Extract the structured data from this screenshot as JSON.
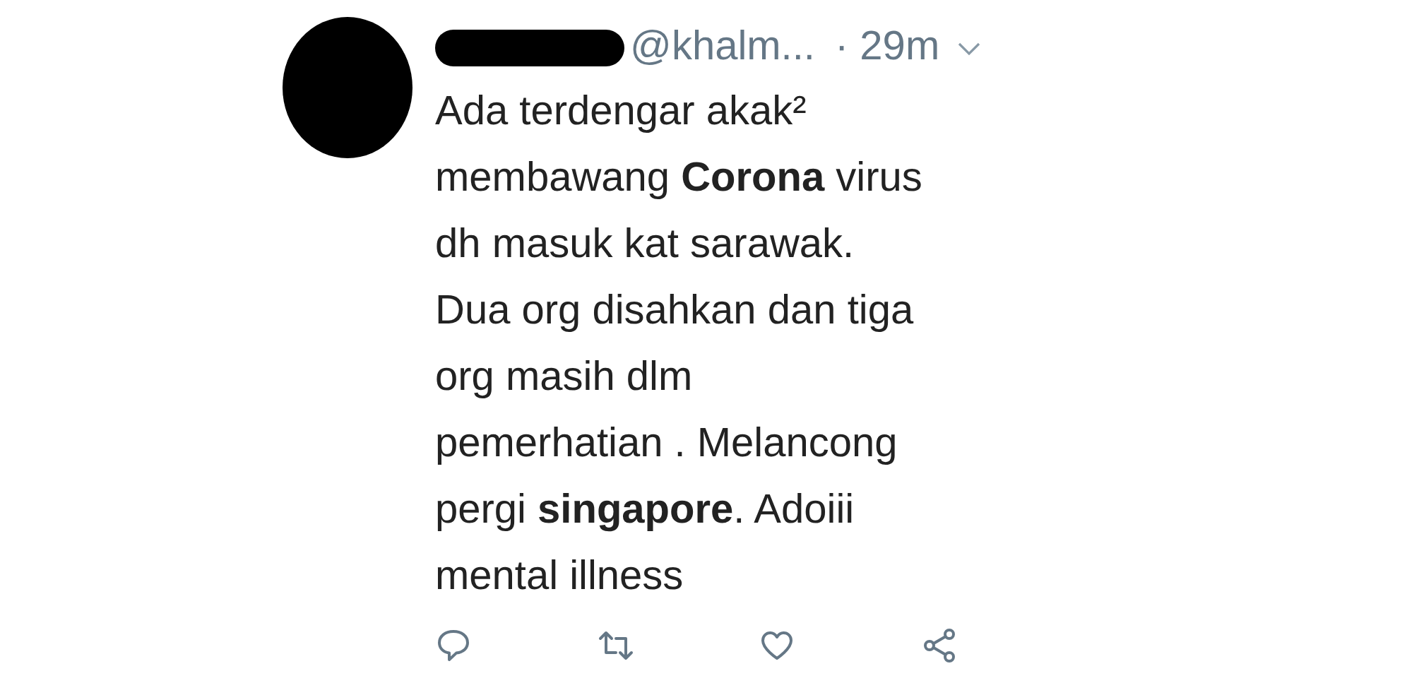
{
  "tweet": {
    "handle": "@khalm...",
    "time": "· 29m",
    "text_lines": [
      "Ada terdengar akak²",
      "membawang **Corona** virus",
      "dh masuk kat sarawak.",
      "Dua org disahkan dan tiga",
      "org masih dlm",
      "pemerhatian . Melancong",
      "pergi **singapore**. Adoiii",
      "mental illness"
    ],
    "actions": [
      {
        "kind": "reply"
      },
      {
        "kind": "retweet"
      },
      {
        "kind": "like"
      },
      {
        "kind": "share"
      }
    ]
  }
}
